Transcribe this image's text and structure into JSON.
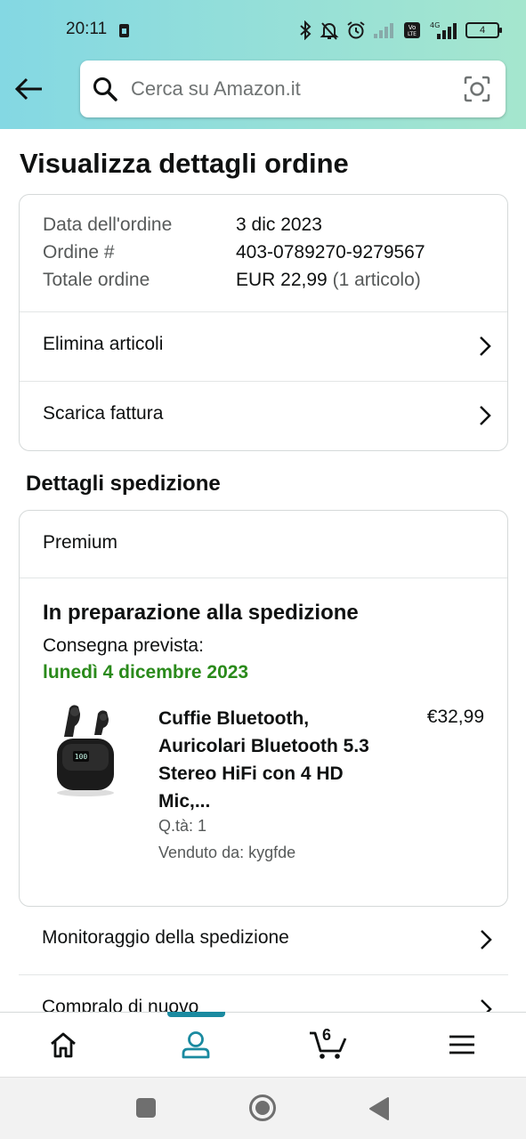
{
  "status_bar": {
    "time": "20:11",
    "battery_level": "4",
    "network_label": "4G",
    "volte_label": "Vo LTE"
  },
  "search": {
    "placeholder": "Cerca su Amazon.it"
  },
  "page": {
    "title": "Visualizza dettagli ordine"
  },
  "order_summary": {
    "rows": [
      {
        "label": "Data dell'ordine",
        "value": "3 dic 2023"
      },
      {
        "label": "Ordine #",
        "value": "403-0789270-9279567"
      },
      {
        "label": "Totale ordine",
        "value": "EUR 22,99",
        "value_suffix": "(1 articolo)"
      }
    ],
    "actions": [
      {
        "label": "Elimina articoli"
      },
      {
        "label": "Scarica fattura"
      }
    ]
  },
  "shipment": {
    "section_title": "Dettagli spedizione",
    "service": "Premium",
    "status": "In preparazione alla spedizione",
    "delivery_label": "Consegna prevista:",
    "delivery_date": "lunedì 4 dicembre 2023",
    "product": {
      "title": "Cuffie Bluetooth, Auricolari Bluetooth 5.3 Stereo HiFi con 4 HD Mic,...",
      "price": "€32,99",
      "quantity": "Q.tà: 1",
      "seller": "Venduto da: kygfde",
      "image_screen_text": "100"
    }
  },
  "more_actions": [
    {
      "label": "Monitoraggio della spedizione"
    },
    {
      "label": "Compralo di nuovo"
    }
  ],
  "bottom_nav": {
    "cart_count": "6",
    "active": "account",
    "accent_color": "#1a8aa0"
  },
  "colors": {
    "delivery_green": "#2a8a1b",
    "header_gradient_start": "#84d8e3",
    "header_gradient_end": "#a5e6ce"
  }
}
